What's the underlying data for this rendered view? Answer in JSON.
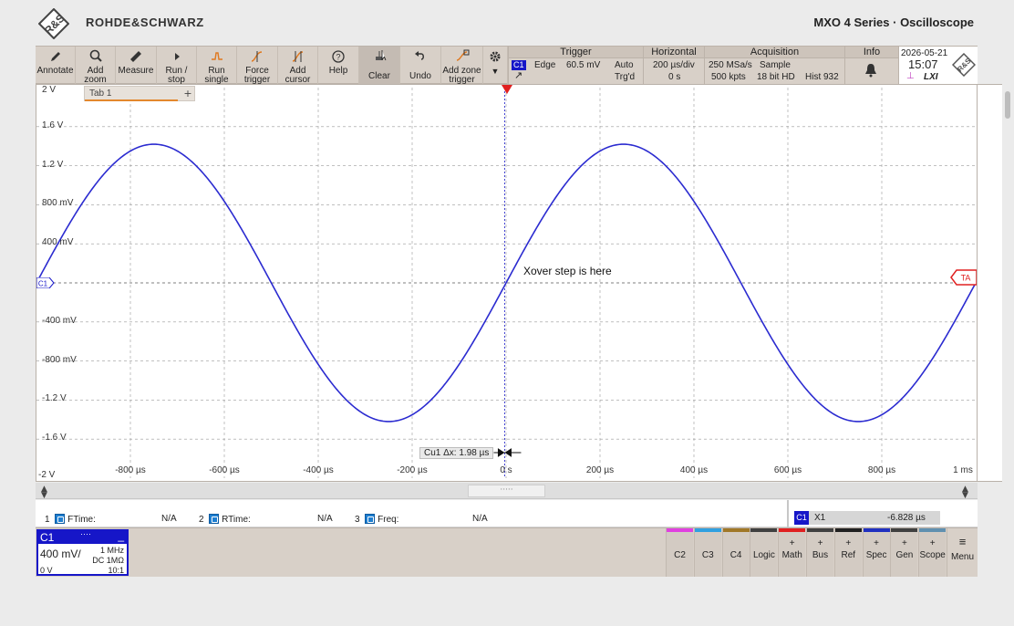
{
  "header": {
    "brand": "ROHDE&SCHWARZ",
    "product": "MXO 4 Series · Oscilloscope"
  },
  "toolbar": {
    "buttons": [
      {
        "label": "Annotate",
        "icon": "pencil-icon"
      },
      {
        "label": "Add zoom",
        "icon": "magnifier-icon"
      },
      {
        "label": "Measure",
        "icon": "ruler-icon"
      },
      {
        "label": "Run / stop",
        "icon": "play-icon"
      },
      {
        "label": "Run single",
        "icon": "single-shot-icon"
      },
      {
        "label": "Force trigger",
        "icon": "force-trigger-icon"
      },
      {
        "label": "Add cursor",
        "icon": "cursor-icon"
      },
      {
        "label": "Help",
        "icon": "help-icon"
      },
      {
        "label": "Clear",
        "icon": "clear-icon"
      },
      {
        "label": "Undo",
        "icon": "undo-icon"
      },
      {
        "label": "Add zone trigger",
        "icon": "zone-trigger-icon"
      }
    ],
    "settings_icon": "gear-icon"
  },
  "trigger": {
    "title": "Trigger",
    "source": "C1",
    "type": "Edge",
    "level": "60.5 mV",
    "mode": "Auto",
    "state": "Trg'd"
  },
  "horizontal": {
    "title": "Horizontal",
    "timebase": "200 µs/div",
    "position": "0 s"
  },
  "acquisition": {
    "title": "Acquisition",
    "sample_rate": "250 MSa/s",
    "record_length": "500 kpts",
    "mode": "Sample",
    "resolution": "18 bit HD",
    "history": "Hist 932"
  },
  "info": {
    "title": "Info",
    "date": "2026-05-21",
    "time": "15:07",
    "lxi": "LXI"
  },
  "display": {
    "tab_label": "Tab 1",
    "tab_add": "+",
    "y_labels": [
      "2 V",
      "1.6 V",
      "1.2 V",
      "800 mV",
      "400 mV",
      "-400 mV",
      "-800 mV",
      "-1.2 V",
      "-1.6 V",
      "-2 V"
    ],
    "x_labels": [
      "-800 µs",
      "-600 µs",
      "-400 µs",
      "-200 µs",
      "0 s",
      "200 µs",
      "400 µs",
      "600 µs",
      "800 µs",
      "1 ms"
    ],
    "channel_marker": "C1",
    "trigger_marker": "TA",
    "annotation": "Xover step is here",
    "cursor_label": "Cu1 Δx: 1.98 µs",
    "colors": {
      "trace": "#2b2bd0",
      "grid": "#9a9a9a",
      "channel": "#1616c8",
      "trigger": "#e02020"
    }
  },
  "waveform": {
    "type": "sine",
    "amplitude_v": 1.42,
    "period_us": 1000,
    "phase_zero_crossing_us": 0,
    "x_range_us": [
      -1000,
      1000
    ],
    "y_range_v": [
      -2,
      2
    ]
  },
  "measurements": [
    {
      "index": "1",
      "name": "FTime:",
      "value": "N/A"
    },
    {
      "index": "2",
      "name": "RTime:",
      "value": "N/A"
    },
    {
      "index": "3",
      "name": "Freq:",
      "value": "N/A"
    }
  ],
  "cursor_readout": {
    "source": "C1",
    "name": "X1",
    "value": "-6.828 µs"
  },
  "channel_box": {
    "name": "C1",
    "minimize": "_",
    "scale": "400 mV/",
    "bandwidth": "1 MHz",
    "coupling": "DC 1MΩ",
    "offset": "0 V",
    "probe": "10:1"
  },
  "bottom_buttons": [
    {
      "label": "C2",
      "color": "#e040e0",
      "plus": ""
    },
    {
      "label": "C3",
      "color": "#30a0e0",
      "plus": ""
    },
    {
      "label": "C4",
      "color": "#a07828",
      "plus": ""
    },
    {
      "label": "Logic",
      "color": "#404040",
      "plus": ""
    },
    {
      "label": "Math",
      "color": "#e02020",
      "plus": "+"
    },
    {
      "label": "Bus",
      "color": "#404040",
      "plus": "+"
    },
    {
      "label": "Ref",
      "color": "#202020",
      "plus": "+"
    },
    {
      "label": "Spec",
      "color": "#2030c0",
      "plus": "+"
    },
    {
      "label": "Gen",
      "color": "#404040",
      "plus": "+"
    },
    {
      "label": "Scope",
      "color": "#6090b0",
      "plus": "+"
    }
  ],
  "menu_label": "Menu"
}
